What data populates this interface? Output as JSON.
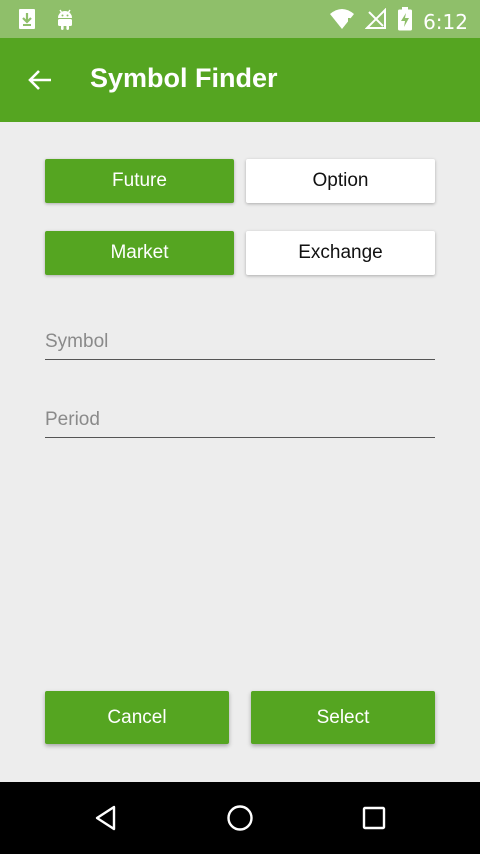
{
  "status_bar": {
    "time": "6:12",
    "icons": [
      "download-icon",
      "android-icon",
      "wifi-icon",
      "no-signal-icon",
      "battery-charging-icon"
    ]
  },
  "toolbar": {
    "back_icon": "arrow-back-icon",
    "title": "Symbol Finder"
  },
  "segments": {
    "type": {
      "future": "Future",
      "option": "Option",
      "selected": "Future"
    },
    "source": {
      "market": "Market",
      "exchange": "Exchange",
      "selected": "Market"
    }
  },
  "fields": {
    "symbol": {
      "placeholder": "Symbol",
      "value": ""
    },
    "period": {
      "placeholder": "Period",
      "value": ""
    }
  },
  "actions": {
    "cancel": "Cancel",
    "select": "Select"
  },
  "nav_bar": {
    "icons": [
      "back-triangle-icon",
      "home-circle-icon",
      "recents-square-icon"
    ]
  },
  "colors": {
    "accent": "#55a521",
    "status_bar": "#8fbf6a",
    "background": "#ededed"
  }
}
